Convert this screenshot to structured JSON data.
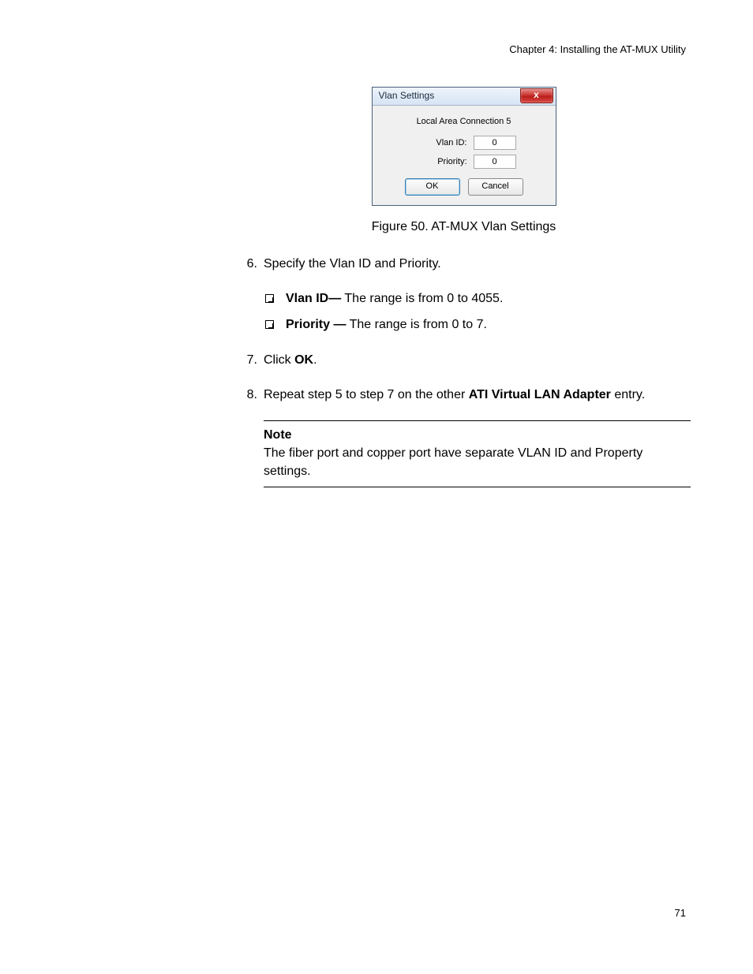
{
  "header": {
    "chapter": "Chapter 4: Installing the AT-MUX Utility"
  },
  "page_number": "71",
  "dialog": {
    "title": "Vlan Settings",
    "close_glyph": "x",
    "connection": "Local Area Connection 5",
    "vlan_id_label": "Vlan ID:",
    "vlan_id_value": "0",
    "priority_label": "Priority:",
    "priority_value": "0",
    "ok_label": "OK",
    "cancel_label": "Cancel"
  },
  "figure_caption": "Figure 50. AT-MUX Vlan Settings",
  "steps": {
    "s6_num": "6.",
    "s6_text": "Specify the Vlan ID and Priority.",
    "bullet_a_bold": "Vlan ID—",
    "bullet_a_rest": " The range is from 0 to 4055.",
    "bullet_b_bold": "Priority —",
    "bullet_b_rest": " The range is from 0 to 7.",
    "s7_num": "7.",
    "s7_pre": "Click ",
    "s7_bold": "OK",
    "s7_post": ".",
    "s8_num": "8.",
    "s8_pre": "Repeat step 5 to step 7 on the other ",
    "s8_bold": "ATI Virtual LAN Adapter",
    "s8_post": " entry."
  },
  "note": {
    "title": "Note",
    "body": "The fiber port and copper port have separate VLAN ID and Property settings."
  }
}
